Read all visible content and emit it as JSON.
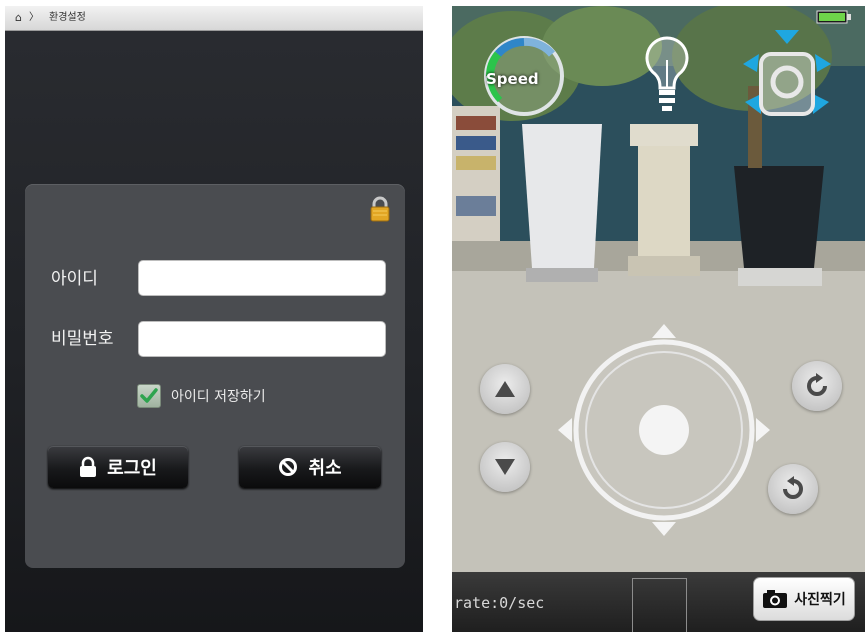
{
  "login_screen": {
    "status_bar": {
      "home_icon": "home-icon",
      "separator": "〉",
      "title": "환경설정"
    },
    "lock_icon": "lock-icon",
    "id_label": "아이디",
    "id_value": "",
    "password_label": "비밀번호",
    "password_value": "",
    "remember": {
      "label": "아이디 저장하기",
      "checked": true
    },
    "login_button": {
      "label": "로그인",
      "icon": "lock-icon"
    },
    "cancel_button": {
      "label": "취소",
      "icon": "prohibit-icon"
    }
  },
  "control_screen": {
    "speed_label": "Speed",
    "light_icon": "light-bulb-icon",
    "camera_icon": "camera-tilt-icon",
    "battery_icon": "battery-icon",
    "rate_text": "rate:0/sec",
    "photo_button": {
      "label": "사진찍기",
      "icon": "camera-icon"
    },
    "buttons": {
      "up": "triangle-up-icon",
      "down": "triangle-down-icon",
      "rotate_cw": "rotate-cw-icon",
      "rotate_ccw": "rotate-ccw-icon"
    }
  },
  "colors": {
    "panel": "#4a4c50",
    "screen_dark": "#202226",
    "button_dark": "#18191b",
    "lock_gold": "#e2a624",
    "speed_blue": "#2f86c8",
    "speed_green": "#2cc44b",
    "highlight_cyan": "#1fa7e0"
  }
}
